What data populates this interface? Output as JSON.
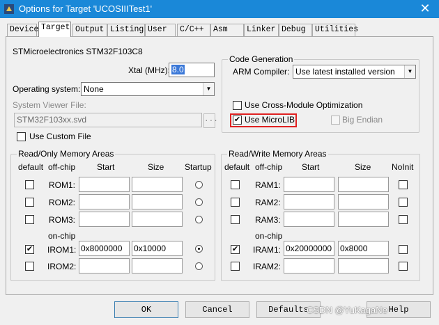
{
  "window": {
    "title": "Options for Target 'UCOSIIITest1'",
    "close_glyph": "✕"
  },
  "tabs": [
    {
      "label": "Device"
    },
    {
      "label": "Target",
      "active": true
    },
    {
      "label": "Output"
    },
    {
      "label": "Listing"
    },
    {
      "label": "User"
    },
    {
      "label": "C/C++"
    },
    {
      "label": "Asm"
    },
    {
      "label": "Linker"
    },
    {
      "label": "Debug"
    },
    {
      "label": "Utilities"
    }
  ],
  "device_name": "STMicroelectronics STM32F103C8",
  "xtal": {
    "label": "Xtal (MHz):",
    "value": "8.0"
  },
  "os": {
    "label": "Operating system:",
    "value": "None"
  },
  "svd": {
    "label": "System Viewer File:",
    "value": "STM32F103xx.svd",
    "browse": "..."
  },
  "custom_file": {
    "label": "Use Custom File",
    "checked": false
  },
  "code_gen": {
    "title": "Code Generation",
    "arm_compiler_label": "ARM Compiler:",
    "arm_compiler_value": "Use latest installed version",
    "cross_module": {
      "label": "Use Cross-Module Optimization",
      "checked": false
    },
    "microlib": {
      "label": "Use MicroLIB",
      "checked": true
    },
    "big_endian": {
      "label": "Big Endian",
      "checked": false
    }
  },
  "ro_memory": {
    "title": "Read/Only Memory Areas",
    "headers": {
      "default": "default",
      "offchip": "off-chip",
      "start": "Start",
      "size": "Size",
      "startup": "Startup"
    },
    "onchip_label": "on-chip",
    "rows": [
      {
        "name": "ROM1:",
        "default": false,
        "start": "",
        "size": "",
        "startup": false
      },
      {
        "name": "ROM2:",
        "default": false,
        "start": "",
        "size": "",
        "startup": false
      },
      {
        "name": "ROM3:",
        "default": false,
        "start": "",
        "size": "",
        "startup": false
      },
      {
        "name": "IROM1:",
        "default": true,
        "start": "0x8000000",
        "size": "0x10000",
        "startup": true
      },
      {
        "name": "IROM2:",
        "default": false,
        "start": "",
        "size": "",
        "startup": false
      }
    ]
  },
  "rw_memory": {
    "title": "Read/Write Memory Areas",
    "headers": {
      "default": "default",
      "offchip": "off-chip",
      "start": "Start",
      "size": "Size",
      "noinit": "NoInit"
    },
    "onchip_label": "on-chip",
    "rows": [
      {
        "name": "RAM1:",
        "default": false,
        "start": "",
        "size": "",
        "noinit": false
      },
      {
        "name": "RAM2:",
        "default": false,
        "start": "",
        "size": "",
        "noinit": false
      },
      {
        "name": "RAM3:",
        "default": false,
        "start": "",
        "size": "",
        "noinit": false
      },
      {
        "name": "IRAM1:",
        "default": true,
        "start": "0x20000000",
        "size": "0x8000",
        "noinit": false
      },
      {
        "name": "IRAM2:",
        "default": false,
        "start": "",
        "size": "",
        "noinit": false
      }
    ]
  },
  "buttons": {
    "ok": "OK",
    "cancel": "Cancel",
    "defaults": "Defaults",
    "help": "Help"
  },
  "watermark": "CSDN @YuKagaNe",
  "check_glyph": "✔",
  "dropdown_glyph": "▼",
  "colors": {
    "titlebar": "#1a88d8",
    "highlight": "#e02020"
  }
}
